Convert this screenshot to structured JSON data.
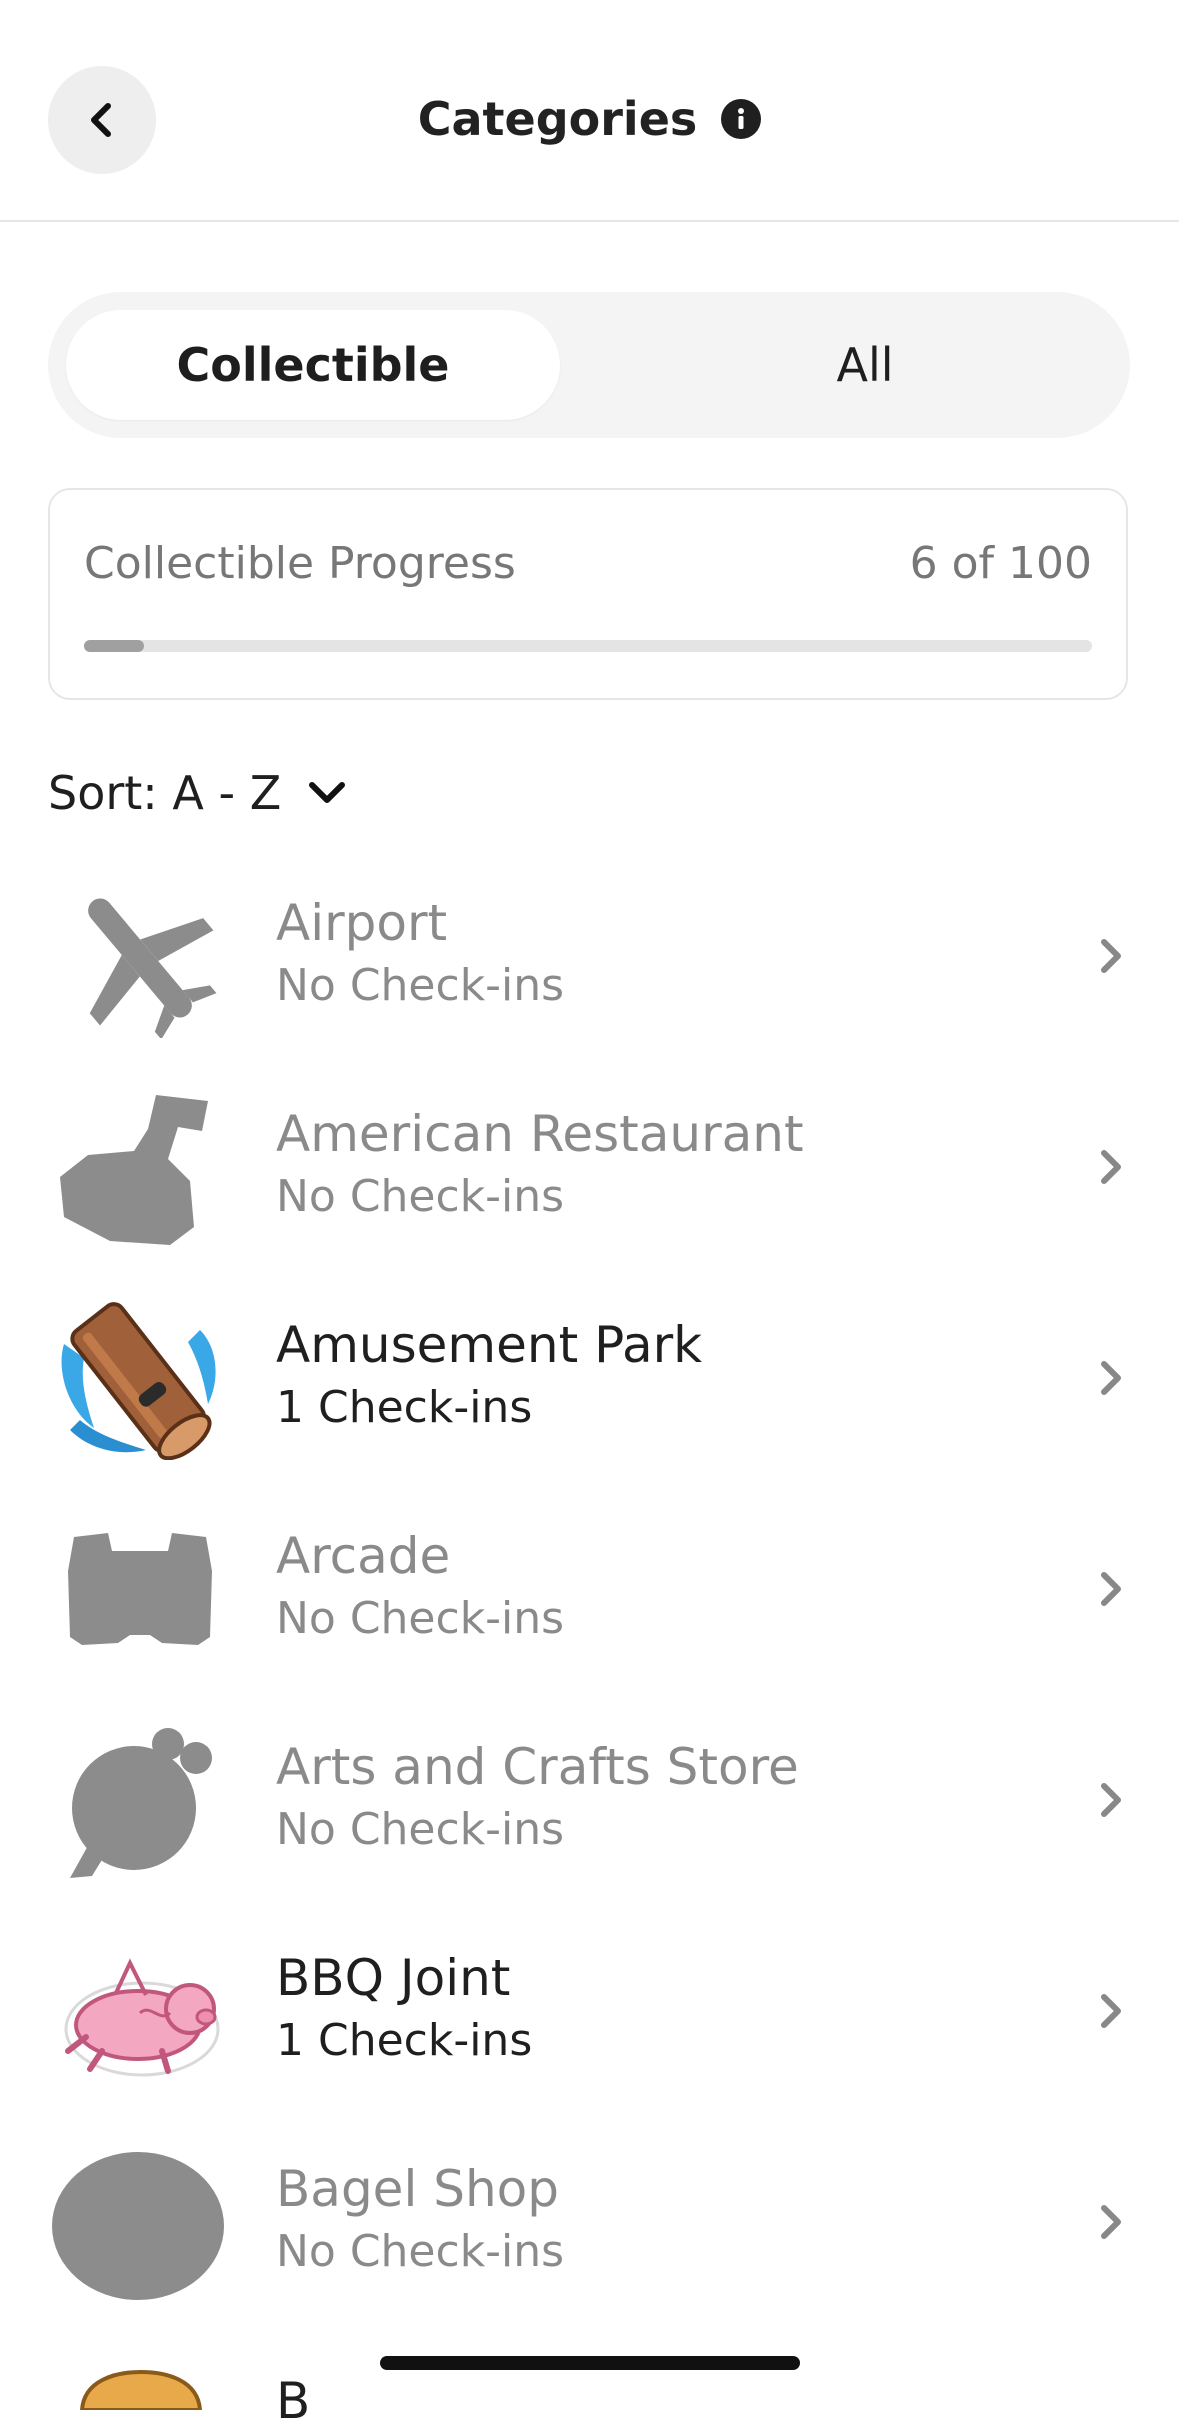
{
  "header": {
    "title": "Categories",
    "back_icon": "chevron-left-icon",
    "info_icon": "info-icon"
  },
  "tabs": [
    {
      "label": "Collectible",
      "selected": true
    },
    {
      "label": "All",
      "selected": false
    }
  ],
  "progress": {
    "label": "Collectible Progress",
    "count_text": "6 of 100",
    "value": 6,
    "max": 100
  },
  "sort": {
    "label": "Sort: A - Z",
    "icon": "chevron-down-icon"
  },
  "categories": [
    {
      "name": "Airport",
      "status": "No Check-ins",
      "collected": false,
      "icon": "airplane-icon"
    },
    {
      "name": "American Restaurant",
      "status": "No Check-ins",
      "collected": false,
      "icon": "restaurant-icon"
    },
    {
      "name": "Amusement Park",
      "status": "1 Check-ins",
      "collected": true,
      "icon": "log-flume-icon"
    },
    {
      "name": "Arcade",
      "status": "No Check-ins",
      "collected": false,
      "icon": "arcade-icon"
    },
    {
      "name": "Arts and Crafts Store",
      "status": "No Check-ins",
      "collected": false,
      "icon": "yarn-icon"
    },
    {
      "name": "BBQ Joint",
      "status": "1 Check-ins",
      "collected": true,
      "icon": "pig-icon"
    },
    {
      "name": "Bagel Shop",
      "status": "No Check-ins",
      "collected": false,
      "icon": "bagel-icon"
    }
  ],
  "peek_item": {
    "name_partial": "B"
  },
  "colors": {
    "inactive_text": "#8a8a8a",
    "active_text": "#1f1f1f",
    "locked_icon": "#8c8c8c",
    "progress_fill": "#a0a0a0"
  }
}
